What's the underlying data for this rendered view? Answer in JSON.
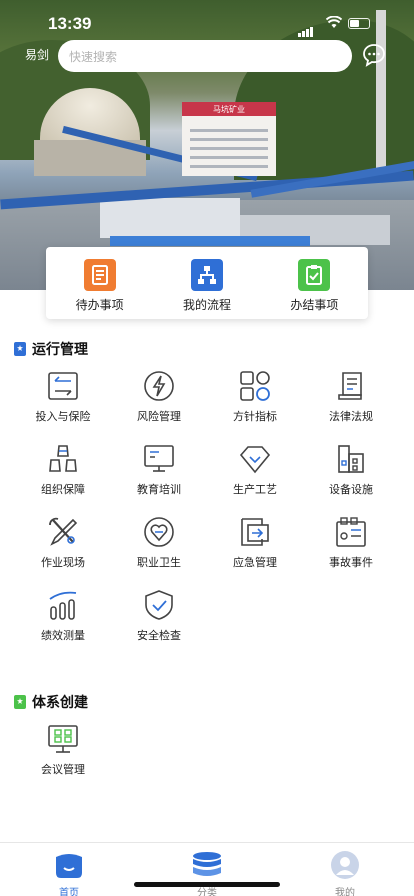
{
  "status_bar": {
    "time": "13:39"
  },
  "header": {
    "username": "易剑",
    "search_placeholder": "快速搜索"
  },
  "banner": {
    "sign_text": "马坑矿业"
  },
  "quick_actions": [
    {
      "label": "待办事项",
      "icon": "todo-icon",
      "color": "#f07c31"
    },
    {
      "label": "我的流程",
      "icon": "workflow-icon",
      "color": "#2f6fd6"
    },
    {
      "label": "办结事项",
      "icon": "completed-icon",
      "color": "#4cc24a"
    }
  ],
  "operations": {
    "title": "运行管理",
    "items": [
      {
        "label": "投入与保险",
        "icon": "exchange-icon"
      },
      {
        "label": "风险管理",
        "icon": "lightning-icon"
      },
      {
        "label": "方针指标",
        "icon": "shapes-icon"
      },
      {
        "label": "法律法规",
        "icon": "scroll-icon"
      },
      {
        "label": "组织保障",
        "icon": "blocks-icon"
      },
      {
        "label": "教育培训",
        "icon": "monitor-icon"
      },
      {
        "label": "生产工艺",
        "icon": "diamond-icon"
      },
      {
        "label": "设备设施",
        "icon": "building-icon"
      },
      {
        "label": "作业现场",
        "icon": "tools-icon"
      },
      {
        "label": "职业卫生",
        "icon": "heart-icon"
      },
      {
        "label": "应急管理",
        "icon": "exit-icon"
      },
      {
        "label": "事故事件",
        "icon": "panel-icon"
      },
      {
        "label": "绩效测量",
        "icon": "bar-chart-icon"
      },
      {
        "label": "安全检查",
        "icon": "shield-check-icon"
      }
    ]
  },
  "system": {
    "title": "体系创建",
    "items": [
      {
        "label": "会议管理",
        "icon": "meeting-board-icon"
      }
    ]
  },
  "tabbar": [
    {
      "label": "首页",
      "icon": "home-icon",
      "active": true
    },
    {
      "label": "分类",
      "icon": "category-icon",
      "active": false
    },
    {
      "label": "我的",
      "icon": "profile-icon",
      "active": false
    }
  ],
  "colors": {
    "accent": "#2f6fd6",
    "icon_dark": "#444444",
    "icon_blue": "#2f6fd6",
    "section_mark_blue": "#2f6fd6",
    "section_mark_green": "#4cc24a"
  }
}
